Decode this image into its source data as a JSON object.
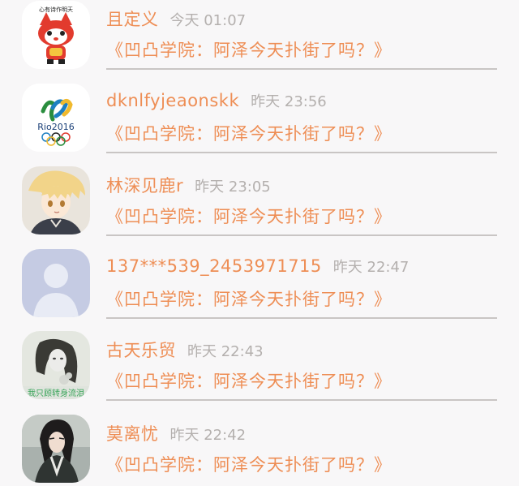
{
  "comments": [
    {
      "name": "且定义",
      "time": "今天 01:07",
      "message": "《凹凸学院：阿泽今天扑街了吗？》",
      "avatar": "fox-cartoon-avatar",
      "avatar_text": "心有诗作明天"
    },
    {
      "name": "dknlfyjeaonskk",
      "time": "昨天 23:56",
      "message": "《凹凸学院：阿泽今天扑街了吗？》",
      "avatar": "rio2016-logo-avatar",
      "avatar_text": "Rio2016"
    },
    {
      "name": "林深见鹿r",
      "time": "昨天 23:05",
      "message": "《凹凸学院：阿泽今天扑街了吗？》",
      "avatar": "anime-boy-avatar"
    },
    {
      "name": "137***539_2453971715",
      "time": "昨天 22:47",
      "message": "《凹凸学院：阿泽今天扑街了吗？》",
      "avatar": "default-user-avatar"
    },
    {
      "name": "古天乐贸",
      "time": "昨天 22:43",
      "message": "《凹凸学院：阿泽今天扑街了吗？》",
      "avatar": "girl-photo-avatar",
      "avatar_text": "我只顾转身流泪"
    },
    {
      "name": "莫离忧",
      "time": "昨天 22:42",
      "message": "《凹凸学院：阿泽今天扑街了吗？》",
      "avatar": "costume-man-avatar"
    }
  ],
  "colors": {
    "accent": "#ee8e55",
    "time": "#b4b0ae",
    "divider": "#c9c5c4",
    "background": "#f8f7f8"
  }
}
